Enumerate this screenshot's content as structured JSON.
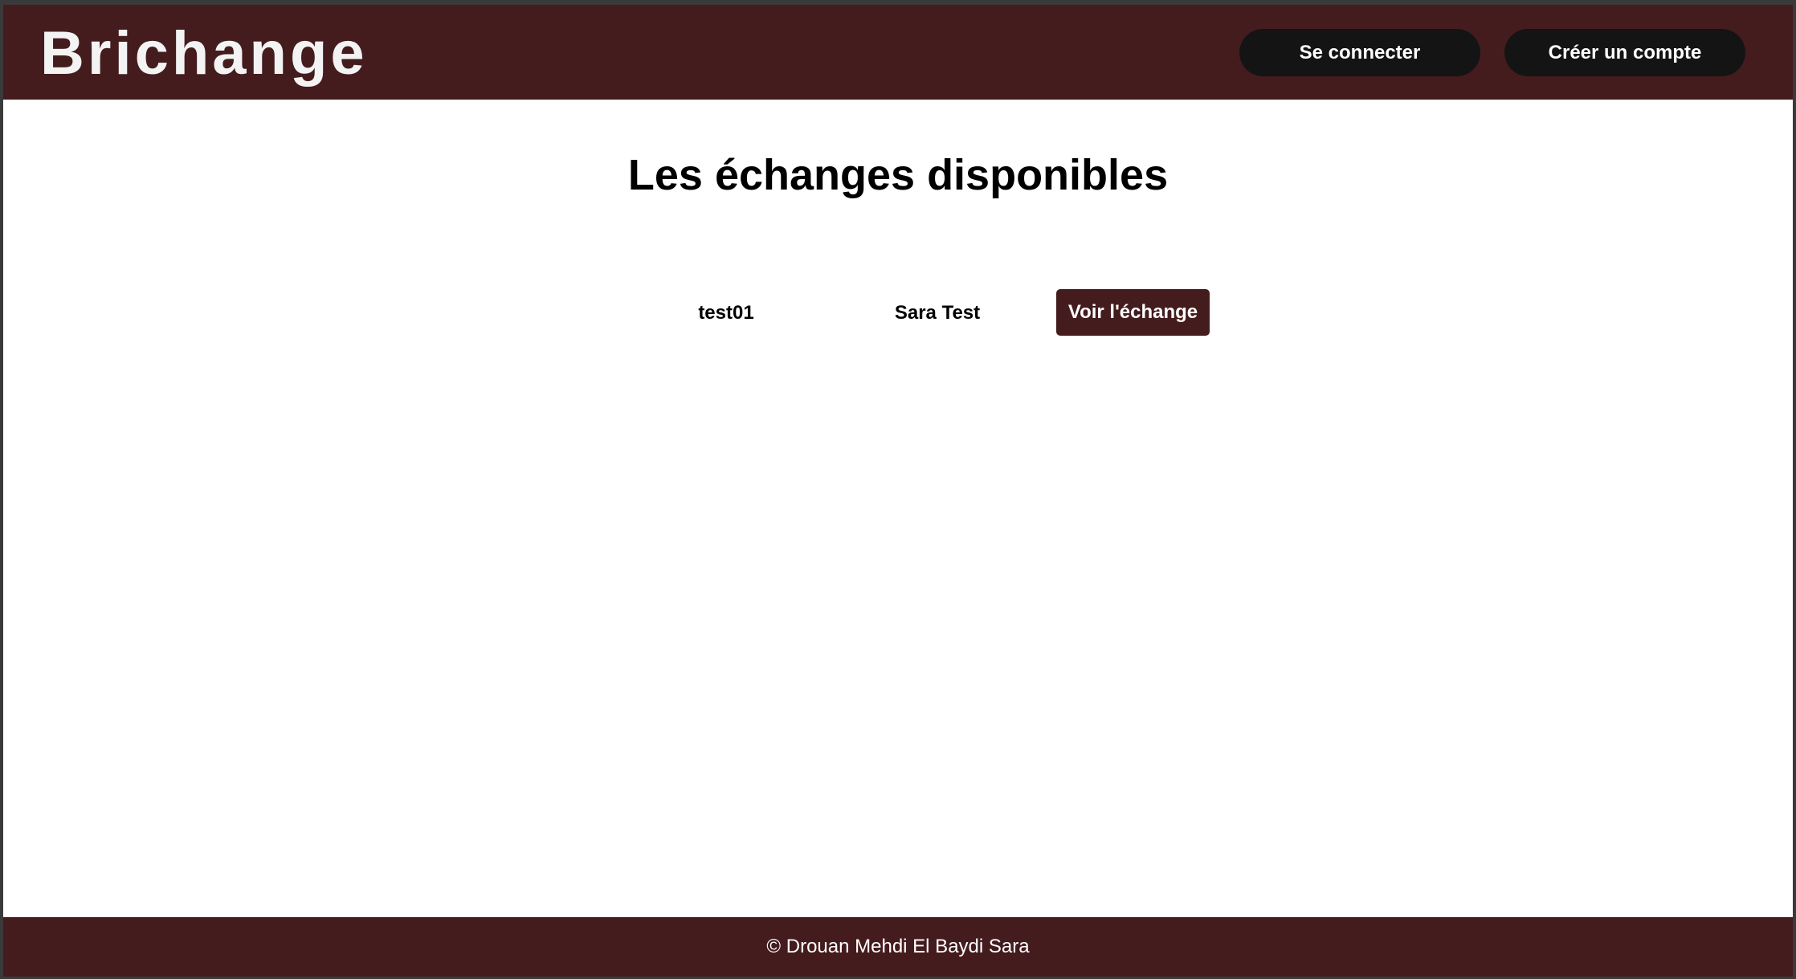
{
  "header": {
    "brand": "Brichange",
    "login_label": "Se connecter",
    "signup_label": "Créer un compte"
  },
  "main": {
    "title": "Les échanges disponibles",
    "exchanges": [
      {
        "title": "test01",
        "user": "Sara Test",
        "action_label": "Voir l'échange"
      }
    ]
  },
  "footer": {
    "text": "© Drouan Mehdi El Baydi Sara"
  },
  "colors": {
    "brand_dark_red": "#441c1e",
    "button_black": "#141414",
    "background": "#ffffff"
  }
}
